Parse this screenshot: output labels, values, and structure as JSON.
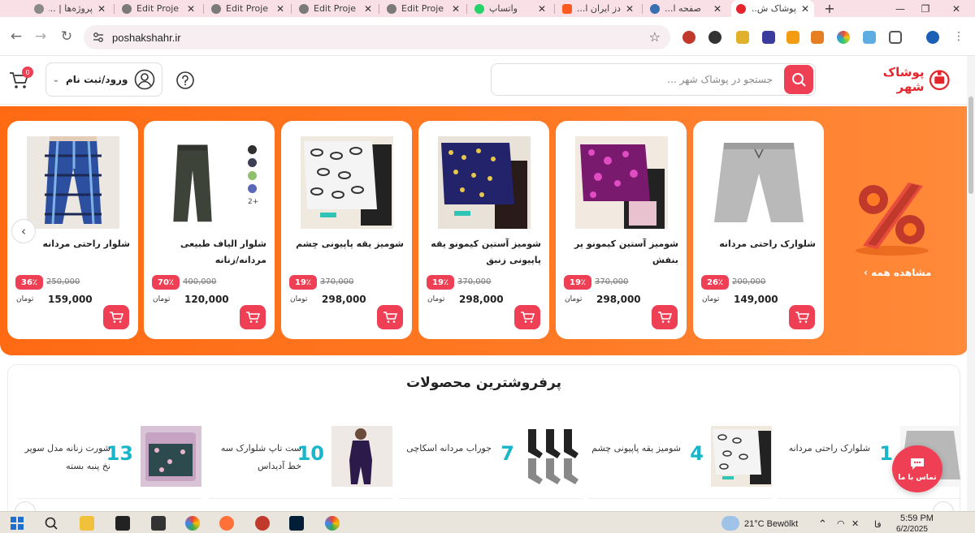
{
  "browser": {
    "tabs": [
      {
        "title": "پروژه‌ها | ...",
        "active": false
      },
      {
        "title": "Edit Proje",
        "active": false
      },
      {
        "title": "Edit Proje",
        "active": false
      },
      {
        "title": "Edit Proje",
        "active": false
      },
      {
        "title": "Edit Proje",
        "active": false
      },
      {
        "title": "واتساپ",
        "active": false
      },
      {
        "title": "دز ایران ا...",
        "active": false
      },
      {
        "title": "صفحه ا...",
        "active": false
      },
      {
        "title": "پوشاک ش...",
        "active": true
      }
    ],
    "url": "poshakshahr.ir"
  },
  "header": {
    "logo_text": "پوشاک شهر",
    "search_placeholder": "جستجو در پوشاک شهر ...",
    "login_label": "ورود/ثبت نام",
    "cart_count": "0"
  },
  "offers": {
    "see_all": "مشاهده همه",
    "products": [
      {
        "title": "شلوارک راحتی مردانه",
        "old_price": "200,000",
        "discount": "26٪",
        "price": "149,000",
        "currency": "تومان"
      },
      {
        "title": "شومیز آستین کیمونو پر بنفش",
        "old_price": "370,000",
        "discount": "19٪",
        "price": "298,000",
        "currency": "تومان"
      },
      {
        "title": "شومیز آستین کیمونو یقه پاپیونی زنبق",
        "old_price": "370,000",
        "discount": "19٪",
        "price": "298,000",
        "currency": "تومان"
      },
      {
        "title": "شومیز یقه پاپیونی چشم",
        "old_price": "370,000",
        "discount": "19٪",
        "price": "298,000",
        "currency": "تومان"
      },
      {
        "title": "شلوار الیاف طبیعی مردانه/زنانه",
        "old_price": "400,000",
        "discount": "70٪",
        "price": "120,000",
        "currency": "تومان",
        "more_colors": "2+"
      },
      {
        "title": "شلوار راحتی مردانه",
        "old_price": "250,000",
        "discount": "36٪",
        "price": "159,000",
        "currency": "تومان"
      }
    ]
  },
  "bestsellers": {
    "title": "پرفروشترین محصولات",
    "items": [
      {
        "rank": "1",
        "name": "شلوارک راحتی مردانه"
      },
      {
        "rank": "4",
        "name": "شومیز یقه پاپیونی چشم"
      },
      {
        "rank": "7",
        "name": "جوراب مردانه اسکاچی"
      },
      {
        "rank": "10",
        "name": "ست تاپ شلوارک سه خط آدیداس"
      },
      {
        "rank": "13",
        "name": "شورت زنانه مدل سوپر نخ پنبه بسته"
      }
    ]
  },
  "contact_label": "تماس با ما",
  "taskbar": {
    "weather": "21°C  Bewölkt",
    "lang": "فا",
    "time": "5:59 PM",
    "date": "6/2/2025"
  },
  "colors": {
    "brand": "#ee3f55",
    "offer_bg": "#ff6a13",
    "rank": "#19b6c9"
  }
}
